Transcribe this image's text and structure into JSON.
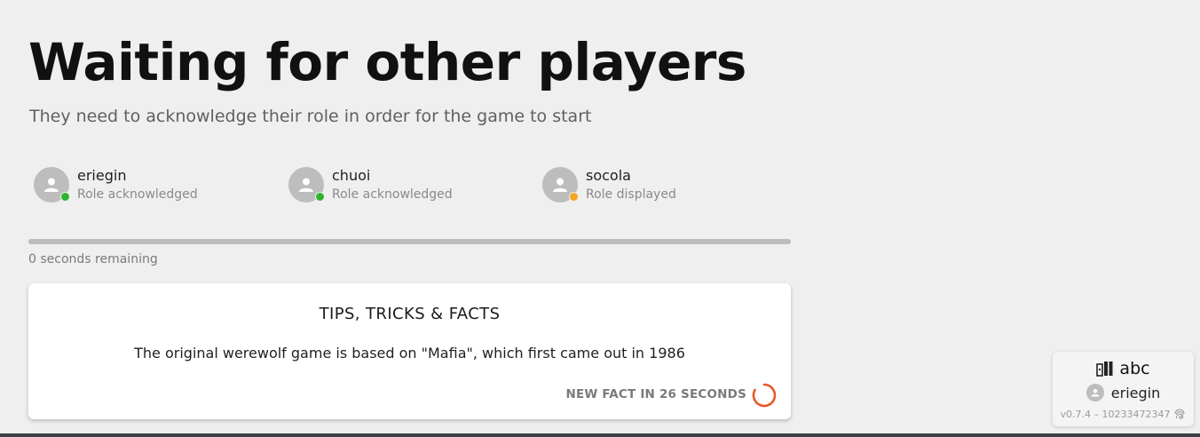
{
  "header": {
    "title": "Waiting for other players",
    "subtitle": "They need to acknowledge their role in order for the game to start"
  },
  "players": [
    {
      "name": "eriegin",
      "status": "Role acknowledged",
      "status_color": "#2db52d"
    },
    {
      "name": "chuoi",
      "status": "Role acknowledged",
      "status_color": "#2db52d"
    },
    {
      "name": "socola",
      "status": "Role displayed",
      "status_color": "#f5a623"
    }
  ],
  "timer": {
    "remaining_label": "0 seconds remaining",
    "progress": 1.0
  },
  "tips": {
    "title": "TIPS, TRICKS & FACTS",
    "fact": "The original werewolf game is based on \"Mafia\", which first came out in 1986",
    "next_label": "NEW FACT IN 26 SECONDS",
    "spinner_color": "#e8572a"
  },
  "session": {
    "room_icon": "room-door-icon",
    "room_name": "abc",
    "user_name": "eriegin",
    "version": "v0.7.4 – 10233472347",
    "fingerprint_icon": "fingerprint-icon"
  }
}
